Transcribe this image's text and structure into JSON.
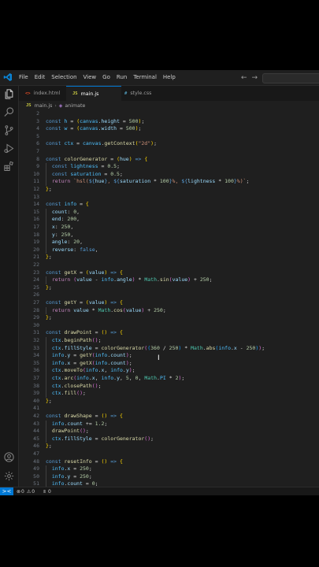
{
  "menu": [
    "File",
    "Edit",
    "Selection",
    "View",
    "Go",
    "Run",
    "Terminal",
    "Help"
  ],
  "nav": {
    "back": "←",
    "forward": "→"
  },
  "tabs": [
    {
      "label": "index.html",
      "icon": "<>",
      "color": "#e44d26",
      "active": false
    },
    {
      "label": "main.js",
      "icon": "JS",
      "color": "#cbcb41",
      "active": true
    },
    {
      "label": "style.css",
      "icon": "#",
      "color": "#519aba",
      "active": false
    }
  ],
  "breadcrumb": {
    "file": "main.js",
    "symbol": "animate"
  },
  "code": {
    "line_numbers": [
      "2",
      "3",
      "4",
      "5",
      "6",
      "7",
      "8",
      "9",
      "10",
      "11",
      "12",
      "13",
      "14",
      "15",
      "16",
      "17",
      "18",
      "19",
      "20",
      "21",
      "22",
      "23",
      "24",
      "25",
      "26",
      "27",
      "28",
      "29",
      "30",
      "31",
      "32",
      "33",
      "34",
      "35",
      "36",
      "37",
      "38",
      "39",
      "40",
      "41",
      "42",
      "43",
      "44",
      "45",
      "46",
      "47",
      "48",
      "49",
      "50",
      "51"
    ]
  },
  "statusbar": {
    "remote": "><",
    "errors": "0",
    "warnings": "0",
    "ports": "0"
  },
  "colors": {
    "editor_bg": "#1f1f1f",
    "accent": "#0078d4",
    "keyword": "#569cd6",
    "function": "#dcdcaa",
    "number": "#b5cea8",
    "string": "#ce9178"
  }
}
